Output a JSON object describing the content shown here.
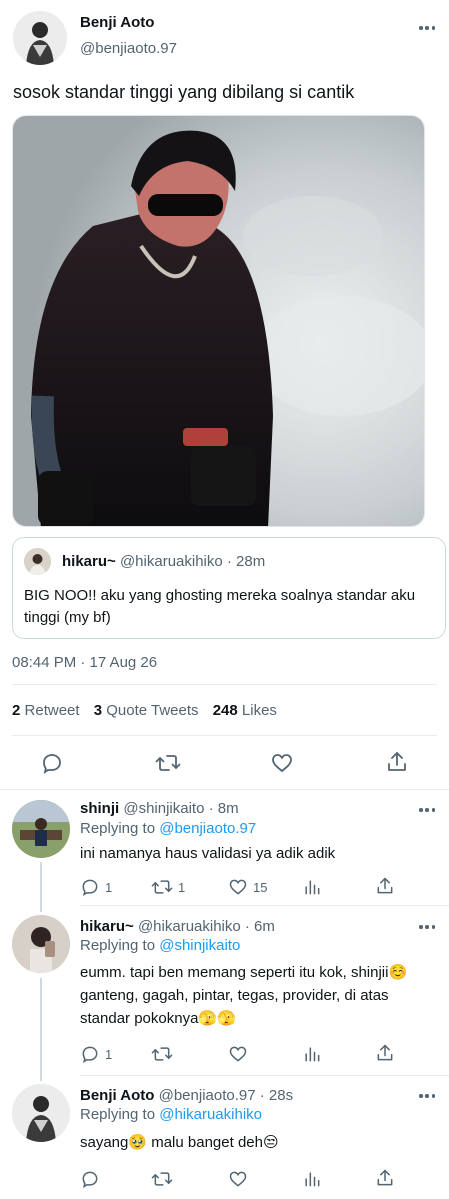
{
  "main_tweet": {
    "author_name": "Benji Aoto",
    "handle": "@benjiaoto.97",
    "text": "sosok standar tinggi yang dibilang si cantik",
    "timestamp": "08:44 PM · 17 Aug 26"
  },
  "quote": {
    "author_name": "hikaru~",
    "meta": "@hikaruakihiko · 28m",
    "text": "BIG NOO!! aku yang ghosting mereka soalnya standar aku tinggi (my bf)"
  },
  "stats": {
    "retweets": "2",
    "retweets_label": "Retweet",
    "quotes": "3",
    "quotes_label": "Quote Tweets",
    "likes": "248",
    "likes_label": "Likes"
  },
  "replies": [
    {
      "name": "shinji",
      "meta": "@shinjikaito · 8m",
      "replying_prefix": "Replying to",
      "replying_to": "@benjiaoto.97",
      "text": "ini namanya haus validasi ya adik adik",
      "reply_count": "1",
      "retweet_count": "1",
      "like_count": "15"
    },
    {
      "name": "hikaru~",
      "meta": "@hikaruakihiko · 6m",
      "replying_prefix": "Replying to",
      "replying_to": "@shinjikaito",
      "text": "eumm. tapi ben memang seperti itu kok, shinjii☺️ ganteng, gagah, pintar, tegas, provider, di atas standar pokoknya🫣🫣",
      "reply_count": "1",
      "retweet_count": "",
      "like_count": ""
    },
    {
      "name": "Benji Aoto",
      "meta": "@benjiaoto.97 · 28s",
      "replying_prefix": "Replying to",
      "replying_to": "@hikaruakihiko",
      "text": "sayang🥹 malu banget deh😒",
      "reply_count": "",
      "retweet_count": "",
      "like_count": ""
    }
  ],
  "icons": {
    "reply": "reply-icon",
    "retweet": "retweet-icon",
    "like": "heart-icon",
    "share": "share-icon",
    "analytics": "analytics-icon",
    "more": "more-icon"
  },
  "colors": {
    "accent": "#1d9bf0",
    "text": "#0f1419",
    "secondary": "#536471",
    "border": "#e6ecf0"
  }
}
